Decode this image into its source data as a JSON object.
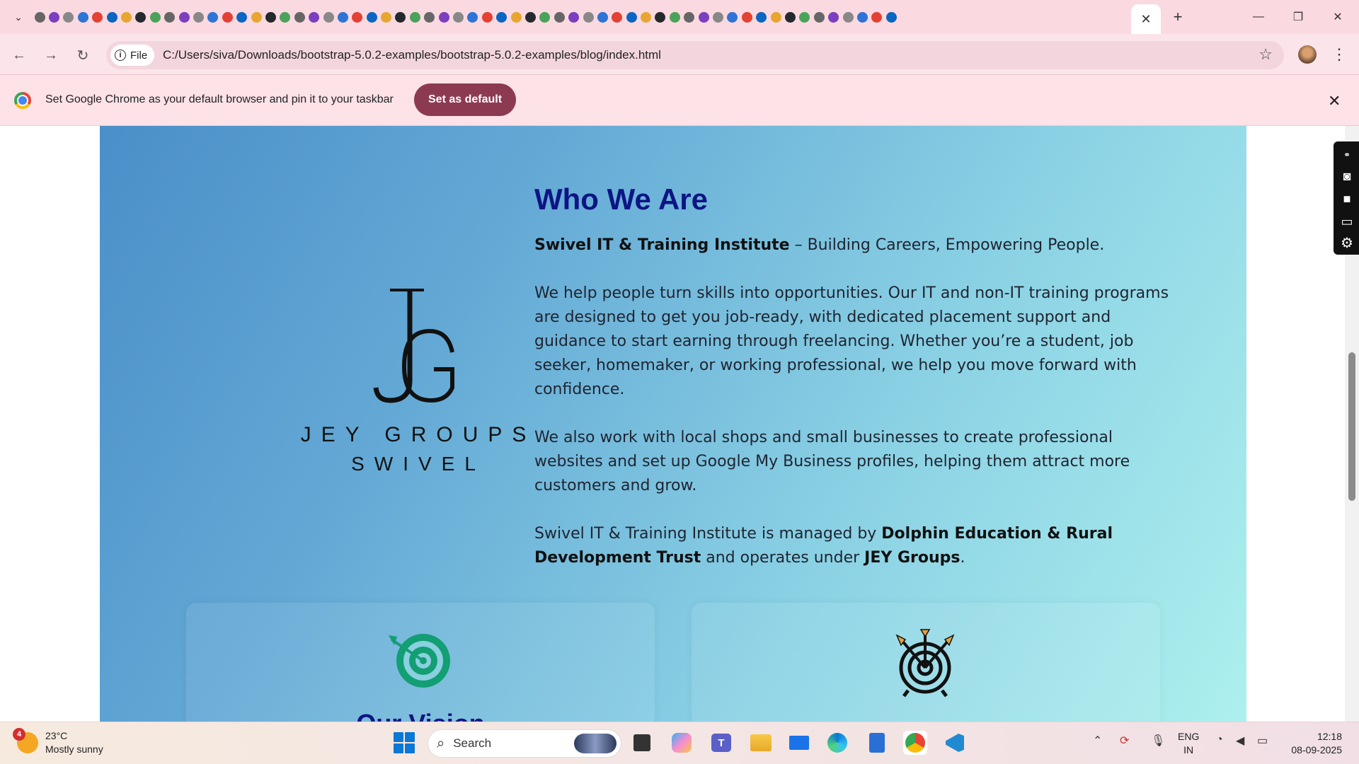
{
  "browser": {
    "active_tab_close": "✕",
    "new_tab": "+",
    "window_controls": {
      "minimize": "—",
      "maximize": "❐",
      "close": "✕"
    },
    "favicon_count": 60,
    "address_chip": "File",
    "url": "C:/Users/siva/Downloads/bootstrap-5.0.2-examples/bootstrap-5.0.2-examples/blog/index.html"
  },
  "infobar": {
    "message": "Set Google Chrome as your default browser and pin it to your taskbar",
    "button": "Set as default",
    "close": "✕"
  },
  "page": {
    "logo": {
      "line1": "JEY GROUPS",
      "line2": "SWIVEL"
    },
    "heading": "Who We Are",
    "tagline_bold": "Swivel IT & Training Institute",
    "tagline_rest": " – Building Careers, Empowering People.",
    "para1": "We help people turn skills into opportunities. Our IT and non-IT training programs are designed to get you job-ready, with dedicated placement support and guidance to start earning through freelancing. Whether you’re a student, job seeker, homemaker, or working professional, we help you move forward with confidence.",
    "para2": "We also work with local shops and small businesses to create professional websites and set up Google My Business profiles, helping them attract more customers and grow.",
    "para3_a": "Swivel IT & Training Institute is managed by ",
    "para3_b": "Dolphin Education & Rural Development Trust",
    "para3_c": " and operates under ",
    "para3_d": "JEY Groups",
    "para3_e": ".",
    "cards": [
      {
        "title": "Our Vision",
        "icon": "target-arrow-icon"
      },
      {
        "title": "",
        "icon": "target-arrows-icon"
      }
    ]
  },
  "taskbar": {
    "weather": {
      "badge": "4",
      "temp": "23°C",
      "desc": "Mostly sunny"
    },
    "search_placeholder": "Search",
    "lang": {
      "line1": "ENG",
      "line2": "IN"
    },
    "time": "12:18",
    "date": "08-09-2025"
  },
  "colors": {
    "heading": "#0d1484",
    "button": "#8c3a52",
    "accent": "#0a78d4"
  }
}
